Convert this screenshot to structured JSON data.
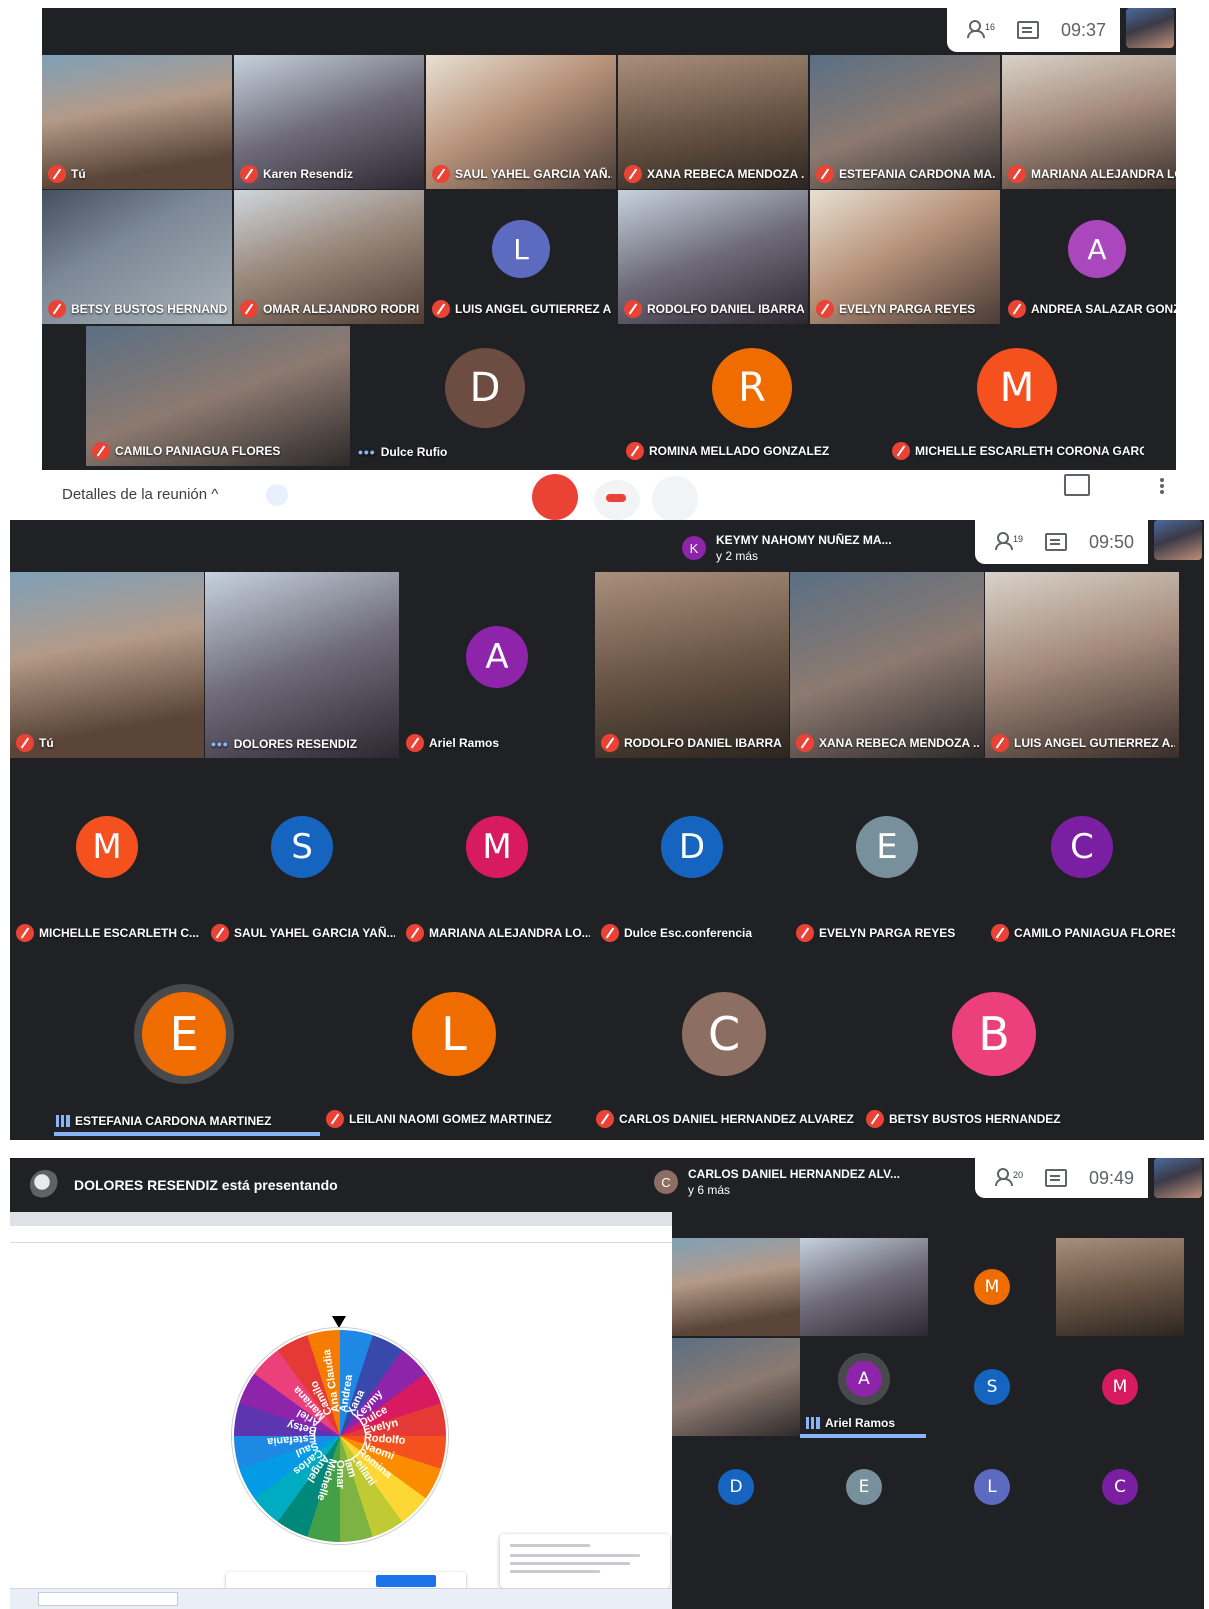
{
  "shot1": {
    "time": "09:37",
    "participant_count": "16",
    "tiles": [
      {
        "name": "Tú",
        "type": "video"
      },
      {
        "name": "Karen Resendiz",
        "type": "video"
      },
      {
        "name": "SAUL YAHEL GARCIA YAÑ...",
        "type": "video"
      },
      {
        "name": "XANA REBECA MENDOZA ...",
        "type": "video"
      },
      {
        "name": "ESTEFANIA CARDONA MA...",
        "type": "video"
      },
      {
        "name": "MARIANA ALEJANDRA LO...",
        "type": "video"
      },
      {
        "name": "BETSY BUSTOS HERNAND...",
        "type": "video"
      },
      {
        "name": "OMAR ALEJANDRO RODRI...",
        "type": "video"
      },
      {
        "name": "LUIS ANGEL GUTIERREZ A...",
        "type": "avatar",
        "letter": "L",
        "color": "#5c6bc0"
      },
      {
        "name": "RODOLFO DANIEL IBARRA ...",
        "type": "video"
      },
      {
        "name": "EVELYN PARGA REYES",
        "type": "video"
      },
      {
        "name": "ANDREA SALAZAR GONZ...",
        "type": "avatar",
        "letter": "A",
        "color": "#ab47bc"
      },
      {
        "name": "CAMILO PANIAGUA FLORES",
        "type": "video"
      },
      {
        "name": "Dulce Rufio",
        "type": "avatar",
        "letter": "D",
        "color": "#6d4c41",
        "status": "dots"
      },
      {
        "name": "ROMINA MELLADO GONZALEZ",
        "type": "avatar",
        "letter": "R",
        "color": "#ef6c00"
      },
      {
        "name": "MICHELLE ESCARLETH CORONA GARCIA",
        "type": "avatar",
        "letter": "M",
        "color": "#f4511e"
      }
    ]
  },
  "controls": {
    "details_label": "Detalles de la reunión  ^"
  },
  "shot2": {
    "time": "09:50",
    "participant_count": "19",
    "join_notice": {
      "letter": "K",
      "name": "KEYMY NAHOMY NUÑEZ MA...",
      "sub": "y 2 más",
      "color": "#8e24aa"
    },
    "tiles": [
      {
        "name": "Tú",
        "type": "video"
      },
      {
        "name": "DOLORES RESENDIZ",
        "type": "video",
        "status": "dots"
      },
      {
        "name": "Ariel Ramos",
        "type": "avatar",
        "letter": "A",
        "color": "#8e24aa"
      },
      {
        "name": "RODOLFO DANIEL IBARRA ...",
        "type": "video"
      },
      {
        "name": "XANA REBECA MENDOZA ...",
        "type": "video"
      },
      {
        "name": "LUIS ANGEL GUTIERREZ A...",
        "type": "video"
      },
      {
        "name": "MICHELLE ESCARLETH C...",
        "type": "avatar",
        "letter": "M",
        "color": "#f4511e"
      },
      {
        "name": "SAUL YAHEL GARCIA YAÑ...",
        "type": "avatar",
        "letter": "S",
        "color": "#1565c0"
      },
      {
        "name": "MARIANA ALEJANDRA LO...",
        "type": "avatar",
        "letter": "M",
        "color": "#d81b60"
      },
      {
        "name": "Dulce Esc.conferencia",
        "type": "avatar",
        "letter": "D",
        "color": "#1565c0"
      },
      {
        "name": "EVELYN PARGA REYES",
        "type": "avatar",
        "letter": "E",
        "color": "#78909c"
      },
      {
        "name": "CAMILO PANIAGUA FLORES",
        "type": "avatar",
        "letter": "C",
        "color": "#7b1fa2"
      },
      {
        "name": "ESTEFANIA CARDONA MARTINEZ",
        "type": "avatar",
        "letter": "E",
        "color": "#ef6c00",
        "status": "speaking"
      },
      {
        "name": "LEILANI NAOMI GOMEZ MARTINEZ",
        "type": "avatar",
        "letter": "L",
        "color": "#ef6c00"
      },
      {
        "name": "CARLOS DANIEL HERNANDEZ ALVAREZ",
        "type": "avatar",
        "letter": "C",
        "color": "#8d6e63"
      },
      {
        "name": "BETSY BUSTOS HERNANDEZ",
        "type": "avatar",
        "letter": "B",
        "color": "#ec407a"
      }
    ]
  },
  "shot3": {
    "time": "09:49",
    "participant_count": "20",
    "presenting_label": "DOLORES RESENDIZ está presentando",
    "join_notice": {
      "letter": "C",
      "name": "CARLOS DANIEL HERNANDEZ ALV...",
      "sub": "y 6 más",
      "color": "#8d6e63"
    },
    "wheel_names": [
      "Andrea",
      "Xana",
      "Keymy",
      "Dulce",
      "Evelyn",
      "Rodolfo",
      "Naomi",
      "Romina",
      "Leilani",
      "Iam",
      "Omar",
      "Michelle",
      "Angel",
      "Carlos",
      "Saul",
      "Estefania",
      "Betsy",
      "Ariel",
      "Mariana",
      "Camilo",
      "Ana Claudia"
    ],
    "side_tiles": [
      {
        "type": "video",
        "name": ""
      },
      {
        "type": "video",
        "name": ""
      },
      {
        "type": "avatar",
        "letter": "M",
        "color": "#ef6c00",
        "name": ""
      },
      {
        "type": "video",
        "name": ""
      },
      {
        "type": "video",
        "name": ""
      },
      {
        "type": "avatar",
        "letter": "A",
        "color": "#8e24aa",
        "name": "Ariel Ramos",
        "status": "speaking"
      },
      {
        "type": "avatar",
        "letter": "S",
        "color": "#1565c0",
        "name": ""
      },
      {
        "type": "avatar",
        "letter": "M",
        "color": "#d81b60",
        "name": ""
      },
      {
        "type": "avatar",
        "letter": "D",
        "color": "#1565c0",
        "name": ""
      },
      {
        "type": "avatar",
        "letter": "E",
        "color": "#78909c",
        "name": ""
      },
      {
        "type": "avatar",
        "letter": "L",
        "color": "#5c6bc0",
        "name": ""
      },
      {
        "type": "avatar",
        "letter": "C",
        "color": "#7b1fa2",
        "name": ""
      }
    ]
  }
}
